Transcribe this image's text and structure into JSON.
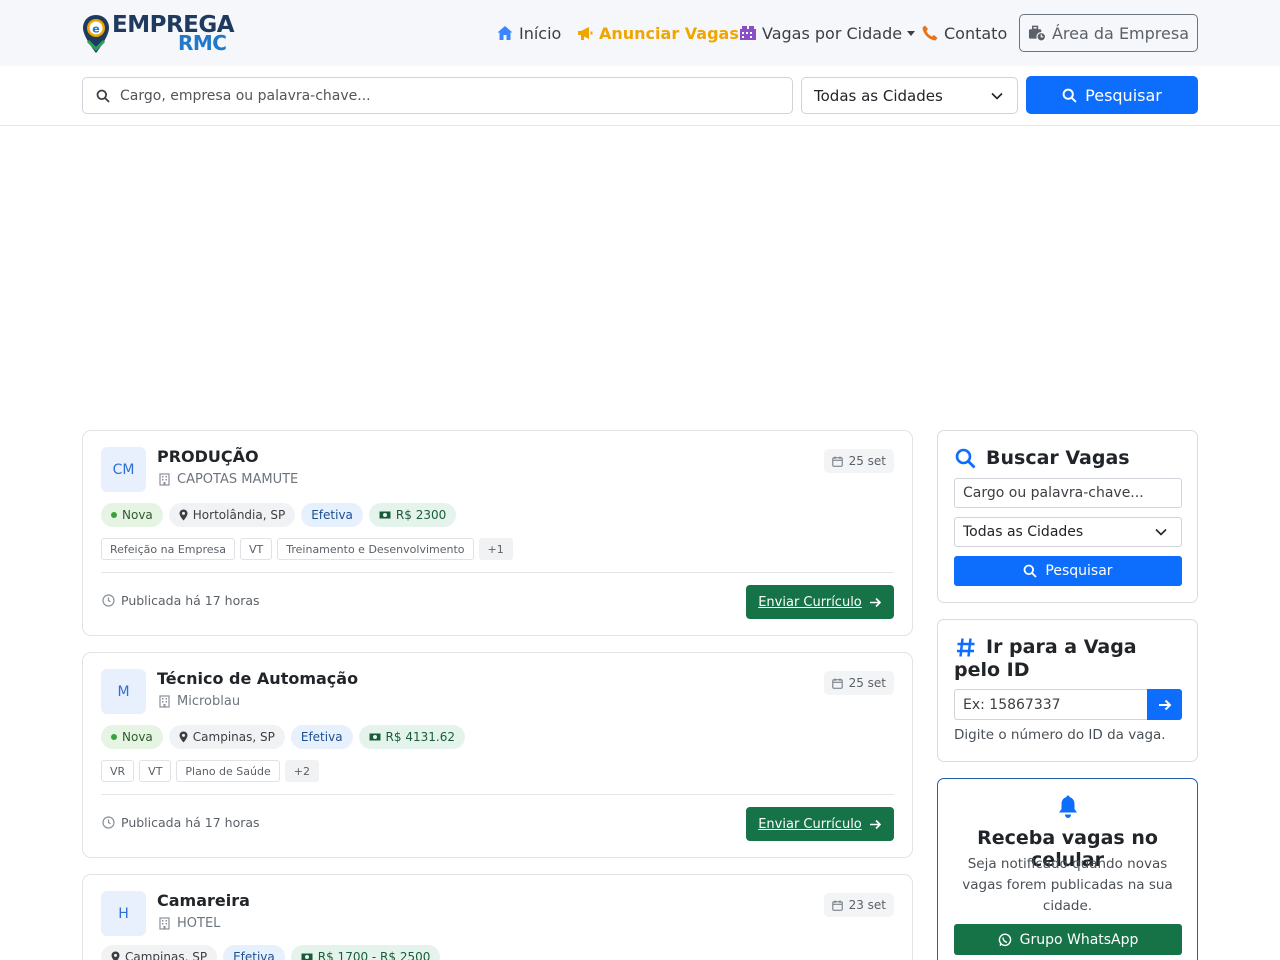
{
  "brand": {
    "name_line1": "EMPREGA",
    "name_line2": "RMC"
  },
  "nav": {
    "inicio": "Início",
    "anunciar": "Anunciar Vagas",
    "cidade": "Vagas por Cidade",
    "contato": "Contato",
    "area_empresa": "Área da Empresa"
  },
  "search": {
    "placeholder": "Cargo, empresa ou palavra-chave...",
    "city_selected": "Todas as Cidades",
    "button_label": "Pesquisar"
  },
  "jobs": [
    {
      "initials": "CM",
      "title": "PRODUÇÃO",
      "company": "CAPOTAS MAMUTE",
      "date": "25 set",
      "status": "Nova",
      "location": "Hortolândia, SP",
      "type": "Efetiva",
      "salary": "R$ 2300",
      "tags": [
        "Refeição na Empresa",
        "VT",
        "Treinamento e Desenvolvimento"
      ],
      "more": "+1",
      "published": "Publicada há 17 horas",
      "send_label": "Enviar Currículo"
    },
    {
      "initials": "M",
      "title": "Técnico de Automação",
      "company": "Microblau",
      "date": "25 set",
      "status": "Nova",
      "location": "Campinas, SP",
      "type": "Efetiva",
      "salary": "R$ 4131.62",
      "tags": [
        "VR",
        "VT",
        "Plano de Saúde"
      ],
      "more": "+2",
      "published": "Publicada há 17 horas",
      "send_label": "Enviar Currículo"
    },
    {
      "initials": "H",
      "title": "Camareira",
      "company": "HOTEL",
      "date": "23 set",
      "location": "Campinas, SP",
      "type": "Efetiva",
      "salary": "R$ 1700 - R$ 2500"
    }
  ],
  "sidebar": {
    "buscar": {
      "title": "Buscar Vagas",
      "placeholder": "Cargo ou palavra-chave...",
      "city_selected": "Todas as Cidades",
      "button_label": "Pesquisar"
    },
    "ir_para": {
      "title": "Ir para a Vaga pelo ID",
      "placeholder": "Ex: 15867337",
      "help": "Digite o número do ID da vaga."
    },
    "notify": {
      "title": "Receba vagas no celular",
      "text": "Seja notificado quando novas vagas forem publicadas na sua cidade.",
      "button_label": "Grupo WhatsApp"
    }
  },
  "colors": {
    "primary": "#0d6efd",
    "success": "#157347",
    "accent": "#f0a500",
    "brand_dark": "#1f3a5f",
    "brand_light": "#1f78c8"
  }
}
